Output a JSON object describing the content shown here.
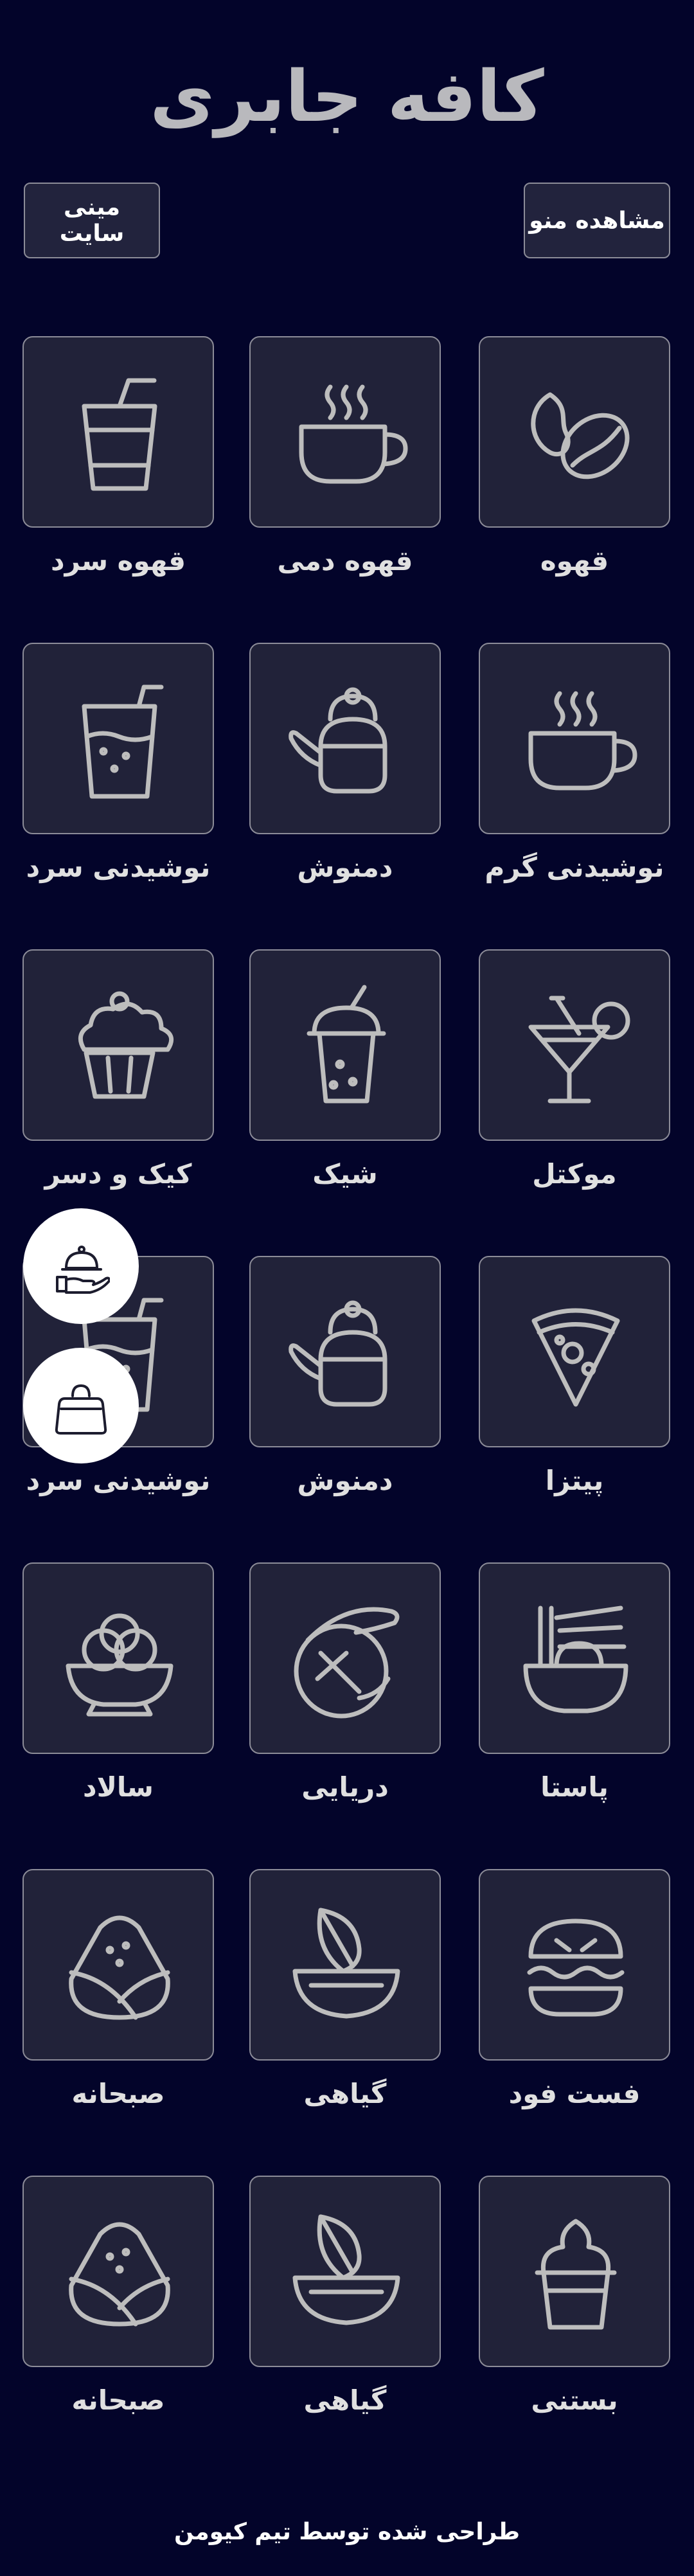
{
  "header": {
    "title": "کافه جابری"
  },
  "buttons": {
    "view_menu": "مشاهده منو",
    "mini_site": "مینی سایت"
  },
  "categories": [
    {
      "label": "قهوه",
      "icon": "coffee-bean-icon"
    },
    {
      "label": "قهوه دمی",
      "icon": "hot-cup-icon"
    },
    {
      "label": "قهوه سرد",
      "icon": "cold-cup-icon"
    },
    {
      "label": "نوشیدنی گرم",
      "icon": "hot-cup-icon"
    },
    {
      "label": "دمنوش",
      "icon": "teapot-icon"
    },
    {
      "label": "نوشیدنی سرد",
      "icon": "cold-drink-icon"
    },
    {
      "label": "موکتل",
      "icon": "cocktail-icon"
    },
    {
      "label": "شیک",
      "icon": "shake-icon"
    },
    {
      "label": "کیک و دسر",
      "icon": "cupcake-icon"
    },
    {
      "label": "پیتزا",
      "icon": "pizza-icon"
    },
    {
      "label": "دمنوش",
      "icon": "teapot-icon"
    },
    {
      "label": "نوشیدنی سرد",
      "icon": "cold-drink-icon"
    },
    {
      "label": "پاستا",
      "icon": "noodle-bowl-icon"
    },
    {
      "label": "دریایی",
      "icon": "shrimp-icon"
    },
    {
      "label": "سالاد",
      "icon": "salad-bowl-icon"
    },
    {
      "label": "فست فود",
      "icon": "burger-icon"
    },
    {
      "label": "گیاهی",
      "icon": "leaf-bowl-icon"
    },
    {
      "label": "صبحانه",
      "icon": "wrap-icon"
    },
    {
      "label": "بستنی",
      "icon": "ice-cream-icon"
    },
    {
      "label": "گیاهی",
      "icon": "leaf-bowl-icon"
    },
    {
      "label": "صبحانه",
      "icon": "wrap-icon"
    }
  ],
  "floating_buttons": [
    {
      "icon": "waiter-service-icon"
    },
    {
      "icon": "bag-icon"
    }
  ],
  "footer": {
    "credit": "طراحی شده توسط تیم کیومن"
  },
  "colors": {
    "background": "#03042a",
    "tile_background": "#212239",
    "tile_border": "#8c8c98",
    "icon_stroke": "#bdbdbd"
  }
}
